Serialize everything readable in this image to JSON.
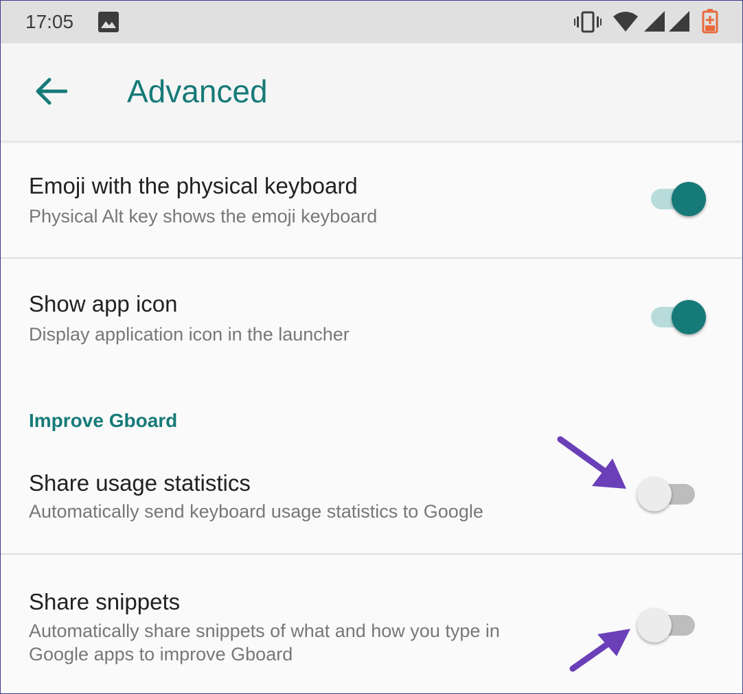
{
  "status_bar": {
    "time": "17:05",
    "icons": [
      "image-icon",
      "vibrate-icon",
      "wifi-icon",
      "signal-icon",
      "signal-icon",
      "battery-charging-icon"
    ]
  },
  "app_bar": {
    "back_icon": "arrow-left-icon",
    "title": "Advanced"
  },
  "settings": [
    {
      "title": "Emoji with the physical keyboard",
      "summary": "Physical Alt key shows the emoji keyboard",
      "enabled": true
    },
    {
      "title": "Show app icon",
      "summary": "Display application icon in the launcher",
      "enabled": true
    }
  ],
  "section": {
    "title": "Improve Gboard",
    "items": [
      {
        "title": "Share usage statistics",
        "summary": "Automatically send keyboard usage statistics to Google",
        "enabled": false
      },
      {
        "title": "Share snippets",
        "summary_line1": "Automatically share snippets of what and how you type in",
        "summary_line2": "Google apps to improve Gboard",
        "enabled": false
      }
    ]
  },
  "colors": {
    "accent": "#167a78",
    "annotation_arrow": "#6a3fb8"
  }
}
